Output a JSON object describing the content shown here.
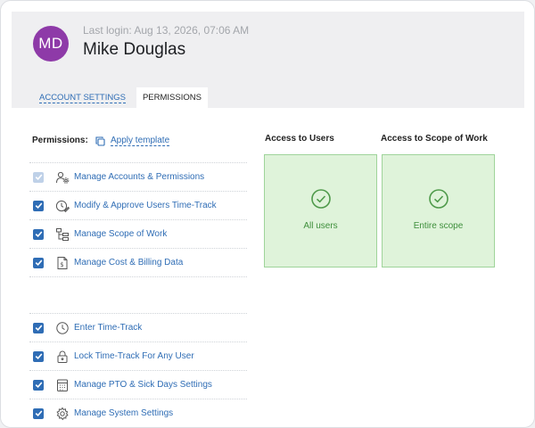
{
  "profile": {
    "initials": "MD",
    "avatar_color": "#8e3aa8",
    "last_login": "Last login: Aug 13, 2026, 07:06 AM",
    "name": "Mike Douglas"
  },
  "tabs": [
    {
      "label": "ACCOUNT SETTINGS",
      "active": false
    },
    {
      "label": "PERMISSIONS",
      "active": true
    }
  ],
  "permissions": {
    "header": "Permissions:",
    "apply_template": "Apply template",
    "group1": [
      {
        "label": "Manage Accounts & Permissions",
        "checked": true,
        "disabled": true,
        "icon": "users-gear-icon"
      },
      {
        "label": "Modify & Approve Users Time-Track",
        "checked": true,
        "disabled": false,
        "icon": "clock-edit-icon"
      },
      {
        "label": "Manage Scope of Work",
        "checked": true,
        "disabled": false,
        "icon": "hierarchy-icon"
      },
      {
        "label": "Manage Cost & Billing Data",
        "checked": true,
        "disabled": false,
        "icon": "invoice-icon"
      }
    ],
    "group2": [
      {
        "label": "Enter Time-Track",
        "checked": true,
        "disabled": false,
        "icon": "clock-icon"
      },
      {
        "label": "Lock Time-Track For Any User",
        "checked": true,
        "disabled": false,
        "icon": "lock-icon"
      },
      {
        "label": "Manage PTO & Sick Days Settings",
        "checked": true,
        "disabled": false,
        "icon": "calendar-icon"
      },
      {
        "label": "Manage System Settings",
        "checked": true,
        "disabled": false,
        "icon": "gear-icon"
      }
    ]
  },
  "access": {
    "users_title": "Access to Users",
    "users_value": "All users",
    "scope_title": "Access to Scope of Work",
    "scope_value": "Entire scope"
  },
  "colors": {
    "accent": "#2f6db5",
    "success_fill": "#dff3da",
    "success_border": "#9fd49a",
    "success_text": "#3f8f3c"
  }
}
